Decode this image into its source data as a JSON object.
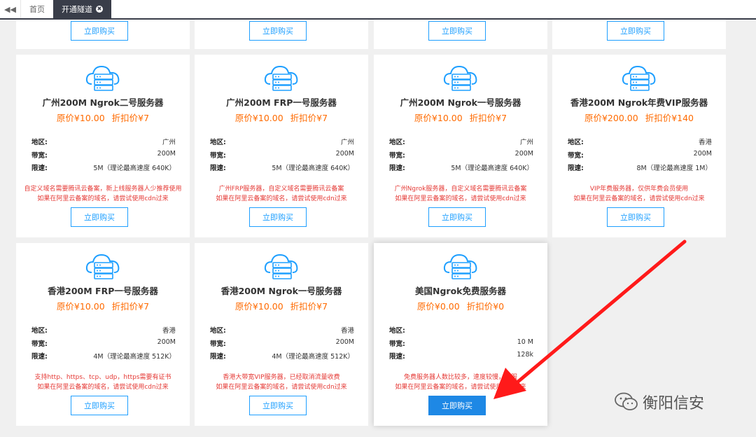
{
  "tabs": [
    {
      "label": "首页",
      "active": false
    },
    {
      "label": "开通隧道",
      "active": true,
      "close": "✖"
    }
  ],
  "buy_label": "立即购买",
  "spec_labels": {
    "region": "地区:",
    "bandwidth": "带宽:",
    "speed": "限速:"
  },
  "cards": [
    {
      "title": "广州200M Ngrok二号服务器",
      "original_price": "原价¥10.00",
      "discount_price": "折扣价¥7",
      "region": "广州",
      "bandwidth": "200M",
      "speed": "5M（理论最高速度 640K）",
      "note_1": "自定义域名需要腾讯云备案，新上线服务器人少推荐使用",
      "note_2": "如果在阿里云备案的域名，请尝试使用cdn过来"
    },
    {
      "title": "广州200M FRP一号服务器",
      "original_price": "原价¥10.00",
      "discount_price": "折扣价¥7",
      "region": "广州",
      "bandwidth": "200M",
      "speed": "5M（理论最高速度 640K）",
      "note_1": "广州FRP服务器，自定义域名需要腾讯云备案",
      "note_2": "如果在阿里云备案的域名，请尝试使用cdn过来"
    },
    {
      "title": "广州200M Ngrok一号服务器",
      "original_price": "原价¥10.00",
      "discount_price": "折扣价¥7",
      "region": "广州",
      "bandwidth": "200M",
      "speed": "5M（理论最高速度 640K）",
      "note_1": "广州Ngrok服务器，自定义域名需要腾讯云备案",
      "note_2": "如果在阿里云备案的域名，请尝试使用cdn过来"
    },
    {
      "title": "香港200M Ngrok年费VIP服务器",
      "original_price": "原价¥200.00",
      "discount_price": "折扣价¥140",
      "region": "香港",
      "bandwidth": "200M",
      "speed": "8M（理论最高速度 1M）",
      "note_1": "VIP年费服务器，仅供年费会员使用",
      "note_2": "如果在阿里云备案的域名，请尝试使用cdn过来"
    },
    {
      "title": "香港200M FRP一号服务器",
      "original_price": "原价¥10.00",
      "discount_price": "折扣价¥7",
      "region": "香港",
      "bandwidth": "200M",
      "speed": "4M（理论最高速度 512K）",
      "note_1": "支持http、https、tcp、udp，https需要有证书",
      "note_2": "如果在阿里云备案的域名，请尝试使用cdn过来"
    },
    {
      "title": "香港200M Ngrok一号服务器",
      "original_price": "原价¥10.00",
      "discount_price": "折扣价¥7",
      "region": "香港",
      "bandwidth": "200M",
      "speed": "4M（理论最高速度 512K）",
      "note_1": "香港大带宽VIP服务器，已经取消流量收费",
      "note_2": "如果在阿里云备案的域名，请尝试使用cdn过来"
    },
    {
      "title": "美国Ngrok免费服务器",
      "original_price": "原价¥0.00",
      "discount_price": "折扣价¥0",
      "region": "",
      "bandwidth": "10 M",
      "speed": "128k",
      "note_1": "免费服务器人数比较多，速度较慢，客服",
      "note_2": "如果在阿里云备案的域名，请尝试使用cdn过来"
    }
  ],
  "watermark": "衡阳信安",
  "colors": {
    "price": "#ff6a00",
    "note": "#e53935",
    "button_border": "#1e9fff",
    "button_primary": "#1e88e5",
    "tab_active": "#393d49",
    "arrow": "#ff1a1a"
  }
}
